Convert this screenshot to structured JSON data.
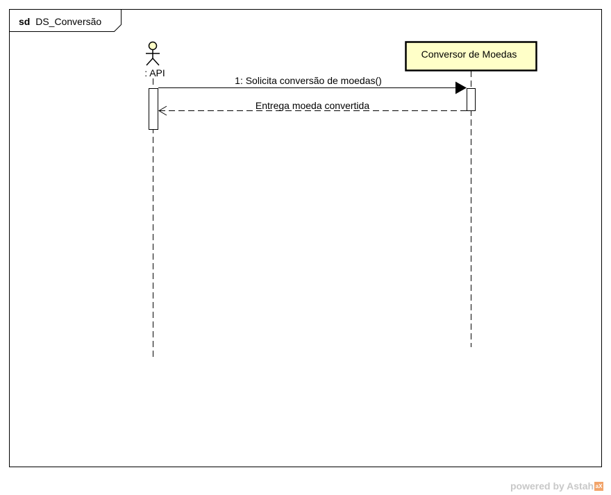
{
  "frame": {
    "keyword": "sd",
    "name": "DS_Conversão"
  },
  "actor": {
    "label": ": API"
  },
  "object": {
    "label": "Conversor de Moedas",
    "fill_color": "#ffffc8"
  },
  "messages": {
    "call": "1: Solicita conversão de moedas()",
    "reply": "Entrega moeda convertida"
  },
  "watermark": {
    "text": "powered by Astah",
    "logo": "aX"
  }
}
